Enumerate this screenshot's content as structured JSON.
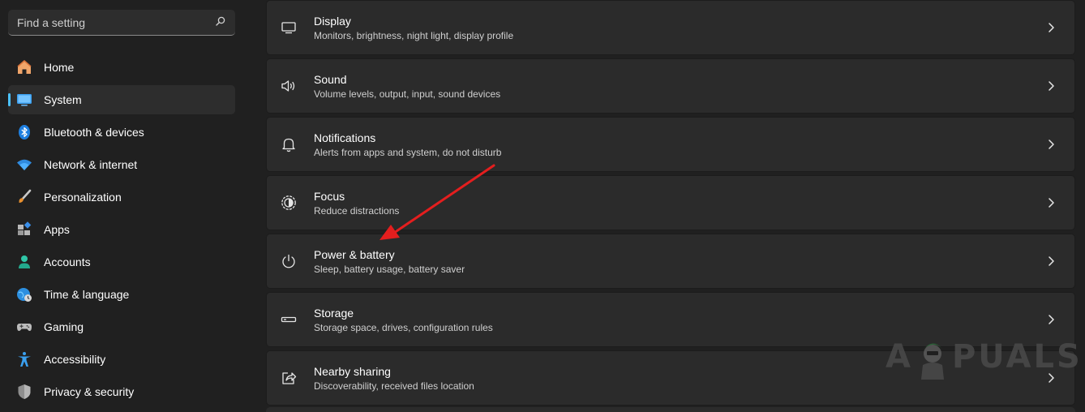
{
  "search": {
    "placeholder": "Find a setting"
  },
  "sidebar": {
    "items": [
      {
        "label": "Home",
        "icon": "home-icon",
        "active": false
      },
      {
        "label": "System",
        "icon": "system-icon",
        "active": true
      },
      {
        "label": "Bluetooth & devices",
        "icon": "bluetooth-icon",
        "active": false
      },
      {
        "label": "Network & internet",
        "icon": "wifi-icon",
        "active": false
      },
      {
        "label": "Personalization",
        "icon": "brush-icon",
        "active": false
      },
      {
        "label": "Apps",
        "icon": "apps-icon",
        "active": false
      },
      {
        "label": "Accounts",
        "icon": "account-icon",
        "active": false
      },
      {
        "label": "Time & language",
        "icon": "globe-clock-icon",
        "active": false
      },
      {
        "label": "Gaming",
        "icon": "gamepad-icon",
        "active": false
      },
      {
        "label": "Accessibility",
        "icon": "accessibility-icon",
        "active": false
      },
      {
        "label": "Privacy & security",
        "icon": "shield-icon",
        "active": false
      }
    ]
  },
  "main": {
    "cards": [
      {
        "title": "Display",
        "subtitle": "Monitors, brightness, night light, display profile",
        "icon": "monitor-icon"
      },
      {
        "title": "Sound",
        "subtitle": "Volume levels, output, input, sound devices",
        "icon": "speaker-icon"
      },
      {
        "title": "Notifications",
        "subtitle": "Alerts from apps and system, do not disturb",
        "icon": "bell-icon"
      },
      {
        "title": "Focus",
        "subtitle": "Reduce distractions",
        "icon": "focus-icon"
      },
      {
        "title": "Power & battery",
        "subtitle": "Sleep, battery usage, battery saver",
        "icon": "power-icon"
      },
      {
        "title": "Storage",
        "subtitle": "Storage space, drives, configuration rules",
        "icon": "storage-icon"
      },
      {
        "title": "Nearby sharing",
        "subtitle": "Discoverability, received files location",
        "icon": "share-icon"
      }
    ]
  },
  "watermark": {
    "text_left": "A",
    "text_right": "PUALS"
  },
  "colors": {
    "accent": "#4cc2ff",
    "annotation_arrow": "#e41e1e",
    "background": "#202020",
    "card": "#2b2b2b"
  }
}
